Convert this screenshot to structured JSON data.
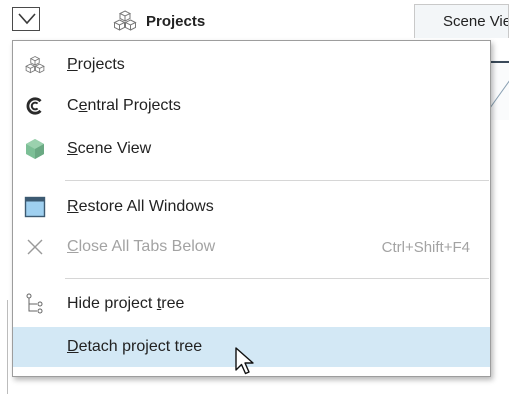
{
  "tabbar": {
    "projects_tab_label": "Projects",
    "scene_tab_label": "Scene View"
  },
  "menu": {
    "items": [
      {
        "pre": "",
        "ul": "P",
        "post": "rojects",
        "shortcut": "",
        "icon": "projects-icon"
      },
      {
        "pre": "C",
        "ul": "e",
        "post": "ntral Projects",
        "shortcut": "",
        "icon": "central-projects-icon"
      },
      {
        "pre": "",
        "ul": "S",
        "post": "cene View",
        "shortcut": "",
        "icon": "scene-view-icon"
      },
      {
        "pre": "",
        "ul": "R",
        "post": "estore All Windows",
        "shortcut": "",
        "icon": "restore-windows-icon"
      },
      {
        "pre": "",
        "ul": "C",
        "post": "lose All Tabs Below",
        "shortcut": "Ctrl+Shift+F4",
        "icon": "close-icon",
        "disabled": true
      },
      {
        "pre": "Hide project ",
        "ul": "t",
        "post": "ree",
        "shortcut": "",
        "icon": "project-tree-icon"
      },
      {
        "pre": "",
        "ul": "D",
        "post": "etach project tree",
        "shortcut": "",
        "icon": "none",
        "highlighted": true
      }
    ]
  },
  "colors": {
    "highlight": "#d3e8f5",
    "scene_green": "#7cbf96",
    "restore_blue": "#9fd0f0",
    "disabled_text": "#a3a3a3"
  }
}
